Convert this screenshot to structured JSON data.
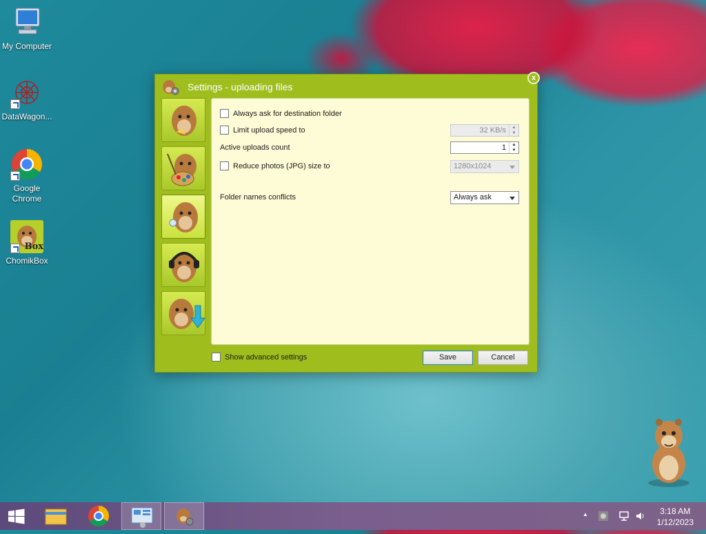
{
  "desktop": {
    "icons": [
      {
        "label": "My Computer"
      },
      {
        "label": "DataWagon..."
      },
      {
        "label": "Google Chrome"
      },
      {
        "label": "ChomikBox",
        "badge": "Box"
      }
    ]
  },
  "dialog": {
    "title": "Settings - uploading files",
    "close_label": "x",
    "sidebar_items": [
      "general-hamster-icon",
      "appearance-hamster-icon",
      "uploading-hamster-icon",
      "notifications-hamster-icon",
      "downloading-hamster-icon"
    ],
    "options": {
      "always_ask_label": "Always ask for destination folder",
      "limit_speed_label": "Limit upload speed to",
      "limit_speed_value": "32 KB/s",
      "active_uploads_label": "Active uploads count",
      "active_uploads_value": "1",
      "reduce_photos_label": "Reduce photos (JPG) size to",
      "reduce_photos_value": "1280x1024",
      "folder_conflicts_label": "Folder names conflicts",
      "folder_conflicts_value": "Always ask"
    },
    "show_advanced_label": "Show advanced settings",
    "save_label": "Save",
    "cancel_label": "Cancel"
  },
  "taskbar": {
    "clock_time": "3:18 AM",
    "clock_date": "1/12/2023",
    "tray_chevron": "▲"
  },
  "colors": {
    "dialog_bg": "#9fbe1e",
    "panel_bg": "#fdfcd6",
    "taskbar": "#6b5684"
  }
}
